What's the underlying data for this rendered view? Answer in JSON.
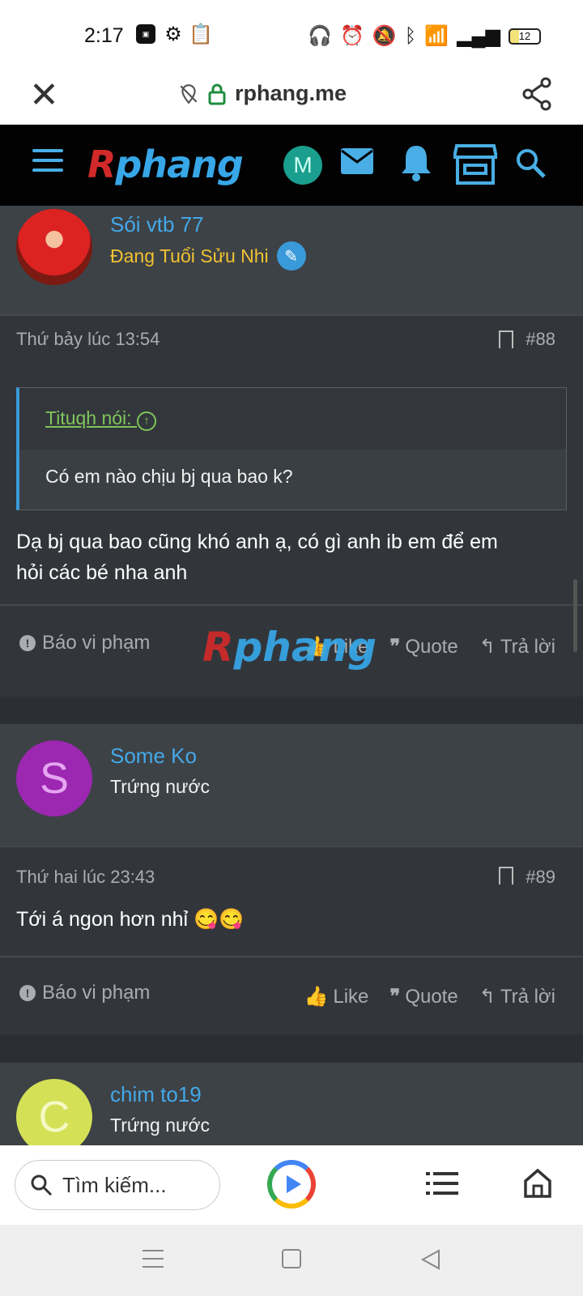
{
  "status_bar": {
    "time": "2:17",
    "battery": "12"
  },
  "browser": {
    "url": "rphang.me"
  },
  "site": {
    "logo_part1": "R",
    "logo_part2": "phang",
    "user_initial": "M"
  },
  "posts": [
    {
      "username": "Sói vtb 77",
      "user_title": "Đang Tuổi Sửu Nhi",
      "timestamp": "Thứ bảy lúc 13:54",
      "post_number": "#88",
      "quote_author": "Tituqh nói:",
      "quote_text": "Có em nào chịu bj qua bao k?",
      "body_line1": "Dạ bj qua bao cũng khó anh ạ, có gì anh ib em để em",
      "body_line2": "hỏi các bé nha anh"
    },
    {
      "username": "Some Ko",
      "user_title": "Trứng nước",
      "avatar_initial": "S",
      "timestamp": "Thứ hai lúc 23:43",
      "post_number": "#89",
      "body": "Tới á ngon hơn nhỉ 😋😋"
    },
    {
      "username": "chim to19",
      "user_title": "Trứng nước",
      "avatar_initial": "C"
    }
  ],
  "actions": {
    "report": "Báo vi phạm",
    "like": "Like",
    "quote": "Quote",
    "reply": "Trả lời"
  },
  "bottom": {
    "search_placeholder": "Tìm kiếm..."
  },
  "colors": {
    "accent": "#44a8e8",
    "background": "#2b2f33",
    "card": "#32363b"
  }
}
